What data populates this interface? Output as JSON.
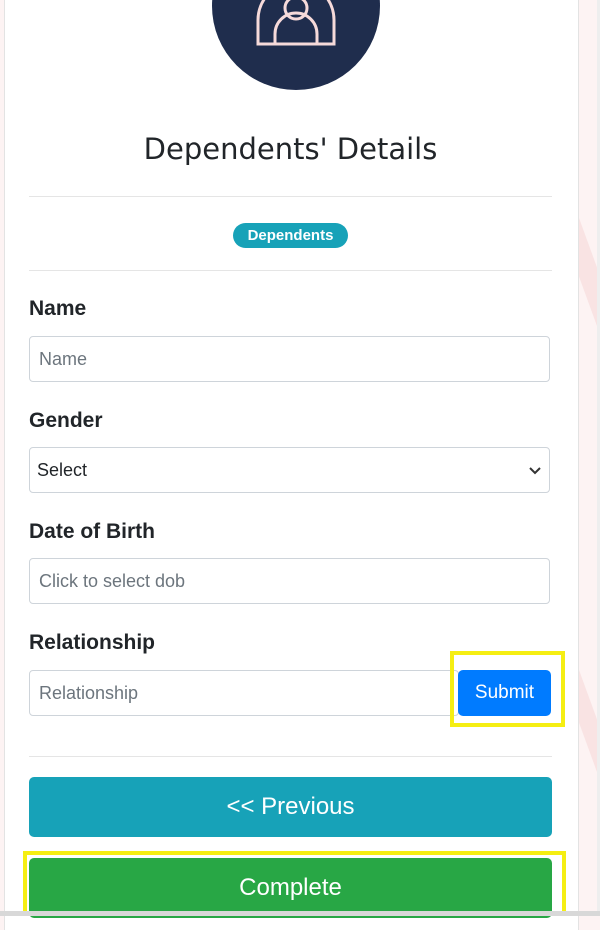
{
  "page": {
    "title": "Dependents' Details",
    "badge": "Dependents"
  },
  "form": {
    "name": {
      "label": "Name",
      "placeholder": "Name"
    },
    "gender": {
      "label": "Gender",
      "value": "Select"
    },
    "dob": {
      "label": "Date of Birth",
      "placeholder": "Click to select dob"
    },
    "relationship": {
      "label": "Relationship",
      "placeholder": "Relationship"
    }
  },
  "buttons": {
    "submit": "Submit",
    "previous": "<< Previous",
    "complete": "Complete"
  },
  "colors": {
    "avatar_bg": "#1f2d4d",
    "badge": "#17a2b8",
    "submit": "#007bff",
    "previous": "#17a2b8",
    "complete": "#28a745",
    "highlight": "#f5ee12"
  },
  "icons": {
    "avatar": "user-group-icon",
    "select": "chevron-down-icon"
  }
}
